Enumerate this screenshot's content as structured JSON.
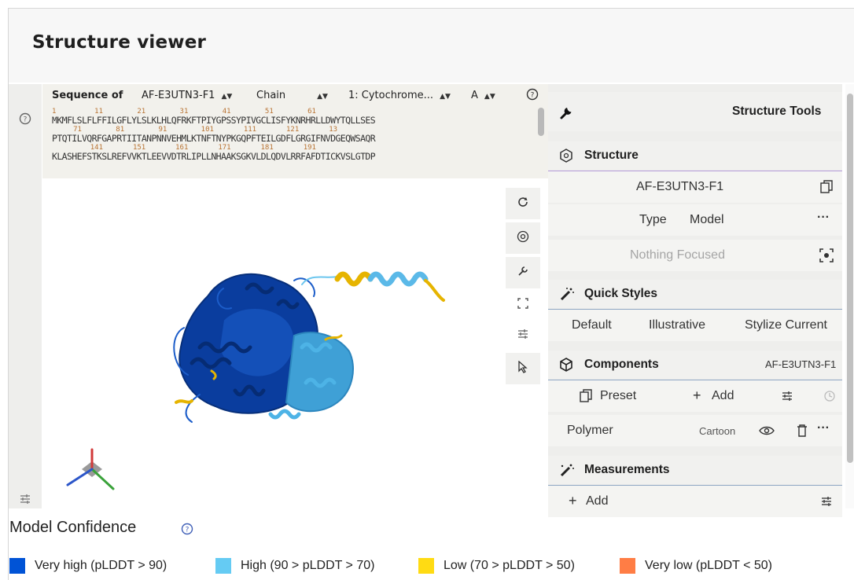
{
  "page": {
    "title": "Structure viewer"
  },
  "sequence": {
    "label": "Sequence of",
    "entry": "AF-E3UTN3-F1",
    "chain_label": "Chain",
    "chain_value": "1: Cytochrome...",
    "chain_id": "A",
    "rows": [
      {
        "nums": "1         11        21        31        41        51        61",
        "seq": "MKMFLSLFLFFILGFLYLSLKLHLQFRKFTPIYGPSSYPIVGCLISFYKNRHRLLDWYTQLLSES"
      },
      {
        "nums": "     71        81        91        101       111       121       13",
        "seq": "PTQTILVQRFGAPRTIITANPNNVEHMLKTNFTNYPKGQPFTEILGDFLGRGIFNVDGEQWSAQR"
      },
      {
        "nums": "         141       151       161       171       181       191",
        "seq": "KLASHEFSTKSLREFVVKTLEEVVDTRLIPLLNHAAKSGKVLDLQDVLRRFAFDTICKVSLGTDP"
      }
    ]
  },
  "viewport_tools": [
    "refresh-icon",
    "camera-icon",
    "wrench-icon",
    "expand-icon",
    "settings-sliders-icon",
    "pointer-icon"
  ],
  "structure_tools": {
    "header": "Structure Tools",
    "structure": {
      "title": "Structure",
      "entry": "AF-E3UTN3-F1",
      "type_label": "Type",
      "type_value": "Model",
      "focus_placeholder": "Nothing Focused"
    },
    "quick_styles": {
      "title": "Quick Styles",
      "options": [
        "Default",
        "Illustrative",
        "Stylize Current"
      ]
    },
    "components": {
      "title": "Components",
      "entry": "AF-E3UTN3-F1",
      "preset_label": "Preset",
      "add_label": "Add",
      "polymer_label": "Polymer",
      "polymer_repr": "Cartoon"
    },
    "measurements": {
      "title": "Measurements",
      "add_label": "Add"
    }
  },
  "confidence": {
    "title": "Model Confidence",
    "legend": [
      {
        "label": "Very high (pLDDT > 90)",
        "color": "#0053d6"
      },
      {
        "label": "High (90 > pLDDT > 70)",
        "color": "#65cbf3"
      },
      {
        "label": "Low (70 > pLDDT > 50)",
        "color": "#ffdb13"
      },
      {
        "label": "Very low (pLDDT < 50)",
        "color": "#ff7d45"
      }
    ]
  }
}
